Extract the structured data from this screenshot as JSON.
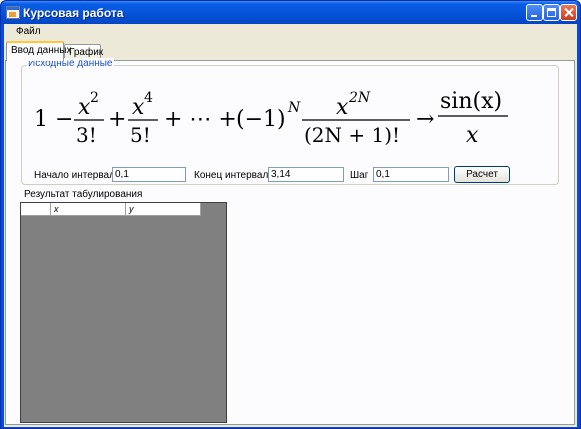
{
  "window": {
    "title": "Курсовая работа"
  },
  "menu": {
    "items": [
      "Файл"
    ]
  },
  "tabs": [
    {
      "label": "Ввод данных",
      "active": true
    },
    {
      "label": "График",
      "active": false
    }
  ],
  "input_group": {
    "title": "Исходные данные",
    "formula": {
      "lead": "1 −",
      "t1_num": "x",
      "t1_exp": "2",
      "t1_den": "3!",
      "plus1": "+",
      "t2_num": "x",
      "t2_exp": "4",
      "t2_den": "5!",
      "dots": "+ ⋯ +",
      "sign": "(−1)",
      "sign_exp": "N",
      "tn_num": "x",
      "tn_exp": "2N",
      "tn_den": "(2N + 1)!",
      "arrow": "→",
      "lim_num": "sin(x)",
      "lim_den": "x"
    },
    "start_label": "Начало интервала",
    "start_value": "0,1",
    "end_label": "Конец интервала",
    "end_value": "3,14",
    "step_label": "Шаг",
    "step_value": "0,1",
    "calc_button": "Расчет"
  },
  "results": {
    "label": "Результат табулирования",
    "columns": [
      "x",
      "y"
    ]
  },
  "colors": {
    "titlebar": "#0452d6",
    "client": "#ece9d8",
    "groupbox_title": "#1a50c8",
    "grid_background": "#808080"
  }
}
